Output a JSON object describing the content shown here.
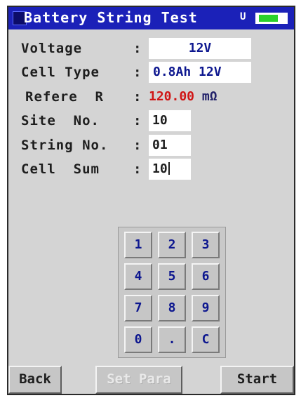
{
  "header": {
    "title": "Battery String Test",
    "indicator": "U",
    "battery_level_fraction": 0.75
  },
  "fields": {
    "voltage": {
      "label": "Voltage",
      "value": "12V"
    },
    "cell_type": {
      "label": "Cell Type",
      "value": "0.8Ah 12V"
    },
    "refere_r": {
      "label": "Refere  R",
      "value": "120.00",
      "unit": "mΩ"
    },
    "site_no": {
      "label": "Site  No.",
      "value": "10"
    },
    "string_no": {
      "label": "String No.",
      "value": "01"
    },
    "cell_sum": {
      "label": "Cell  Sum",
      "value": "10"
    }
  },
  "separator": ":",
  "keypad": {
    "keys": [
      "1",
      "2",
      "3",
      "4",
      "5",
      "6",
      "7",
      "8",
      "9",
      "0",
      ".",
      "C"
    ]
  },
  "buttons": {
    "back": "Back",
    "set_para": "Set Para",
    "start": "Start"
  },
  "colors": {
    "title_bar": "#1b21b8",
    "value_text": "#0d178f",
    "reference_text": "#d01515",
    "battery_fill": "#2bd12b"
  }
}
